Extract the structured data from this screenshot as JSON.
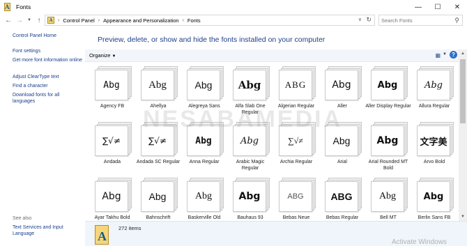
{
  "window": {
    "title": "Fonts"
  },
  "address": {
    "crumbs": [
      "Control Panel",
      "Appearance and Personalization",
      "Fonts"
    ],
    "search_placeholder": "Search Fonts"
  },
  "left_pane": {
    "links": [
      "Control Panel Home",
      "Font settings",
      "Get more font information online",
      "Adjust ClearType text",
      "Find a character",
      "Download fonts for all languages"
    ],
    "see_also_label": "See also",
    "see_also_links": [
      "Text Services and Input Language"
    ]
  },
  "main": {
    "headline": "Preview, delete, or show and hide the fonts installed on your computer",
    "organize_label": "Organize",
    "fonts": [
      {
        "name": "Agency FB",
        "sample": "Abg"
      },
      {
        "name": "Ahellya",
        "sample": "Abg"
      },
      {
        "name": "Alegreya Sans",
        "sample": "Abg"
      },
      {
        "name": "Alfa Slab One Regular",
        "sample": "Abg"
      },
      {
        "name": "Algerian Regular",
        "sample": "ABG"
      },
      {
        "name": "Aller",
        "sample": "Abg"
      },
      {
        "name": "Aller Display Regular",
        "sample": "Abg"
      },
      {
        "name": "Allura Regular",
        "sample": "Abg"
      },
      {
        "name": "Andada",
        "sample": "∑√≠"
      },
      {
        "name": "Andada SC Regular",
        "sample": "∑√≠"
      },
      {
        "name": "Anna Regular",
        "sample": "Abg"
      },
      {
        "name": "Arabic Magic Regular",
        "sample": "Abg"
      },
      {
        "name": "Archia Regular",
        "sample": "∑√≠"
      },
      {
        "name": "Arial",
        "sample": "Abg"
      },
      {
        "name": "Arial Rounded MT Bold",
        "sample": "Abg"
      },
      {
        "name": "Arvo Bold",
        "sample": "文字美"
      },
      {
        "name": "Ayar Takhu Bold",
        "sample": "Abg"
      },
      {
        "name": "Bahnschrift",
        "sample": "Abg"
      },
      {
        "name": "Baskerville Old",
        "sample": "Abg"
      },
      {
        "name": "Bauhaus 93",
        "sample": "Abg"
      },
      {
        "name": "Bebas Neue",
        "sample": "ABG"
      },
      {
        "name": "Bebas Regular",
        "sample": "ABG"
      },
      {
        "name": "Bell MT",
        "sample": "Abg"
      },
      {
        "name": "Berlin Sans FB",
        "sample": "Abg"
      }
    ]
  },
  "status": {
    "count": "272 items"
  },
  "overlay": {
    "watermark": "NESABAMEDIA",
    "activation": "Activate Windows"
  }
}
